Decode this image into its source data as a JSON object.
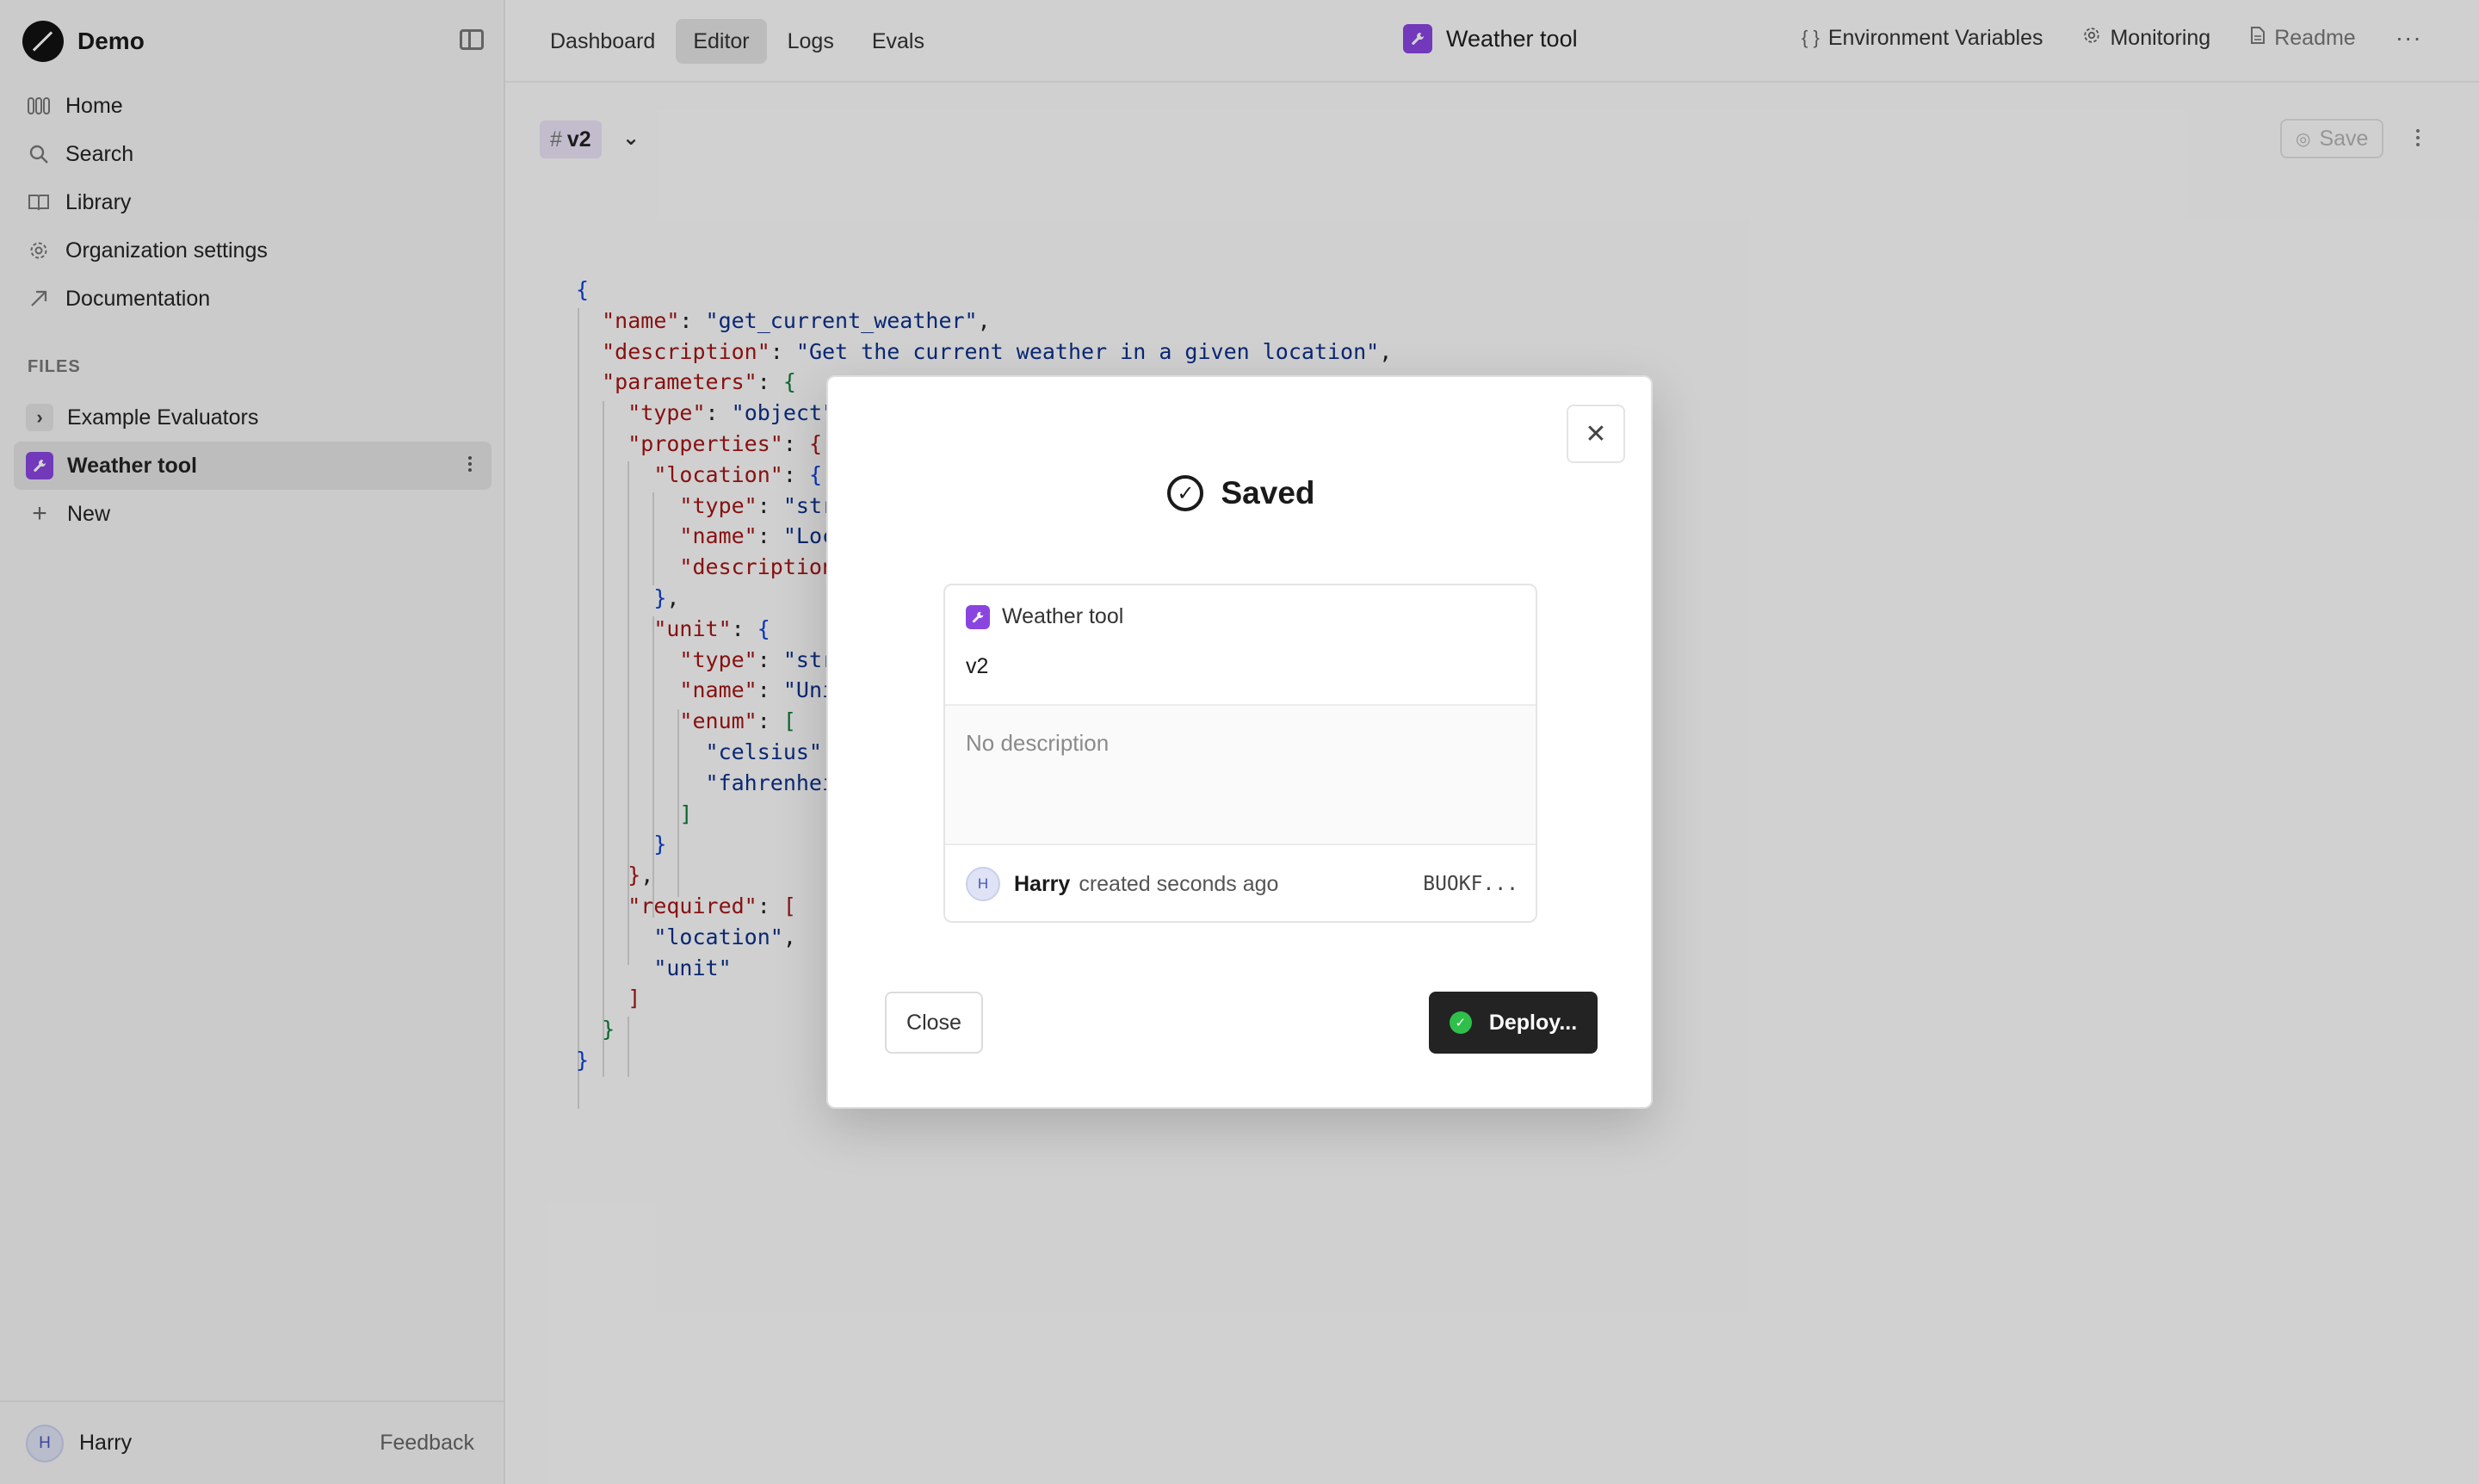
{
  "sidebar": {
    "org_name": "Demo",
    "nav": [
      {
        "label": "Home",
        "icon": "home-icon"
      },
      {
        "label": "Search",
        "icon": "search-icon"
      },
      {
        "label": "Library",
        "icon": "library-icon"
      },
      {
        "label": "Organization settings",
        "icon": "gear-icon"
      },
      {
        "label": "Documentation",
        "icon": "external-link-icon"
      }
    ],
    "files_label": "FILES",
    "files": [
      {
        "label": "Example Evaluators"
      },
      {
        "label": "Weather tool"
      },
      {
        "label": "New"
      }
    ],
    "footer": {
      "avatar_initial": "H",
      "user_name": "Harry",
      "feedback_label": "Feedback"
    }
  },
  "topbar": {
    "tabs": [
      {
        "label": "Dashboard"
      },
      {
        "label": "Editor"
      },
      {
        "label": "Logs"
      },
      {
        "label": "Evals"
      }
    ],
    "active_tab": "Editor",
    "tool_title": "Weather tool",
    "actions": {
      "env_vars": "Environment Variables",
      "monitoring": "Monitoring",
      "readme": "Readme"
    }
  },
  "editor": {
    "version_hash": "#",
    "version_label": "v2",
    "save_label": "Save"
  },
  "code": {
    "name_key": "\"name\"",
    "name_val": "\"get_current_weather\"",
    "desc_key": "\"description\"",
    "desc_val": "\"Get the current weather in a given location\"",
    "params_key": "\"parameters\"",
    "type_key": "\"type\"",
    "type_val": "\"object\"",
    "props_key": "\"properties\"",
    "location_key": "\"location\"",
    "loc_type_key": "\"type\"",
    "loc_type_val": "\"str",
    "loc_name_key": "\"name\"",
    "loc_name_val": "\"Loc",
    "loc_desc_key": "\"description",
    "unit_key": "\"unit\"",
    "unit_type_key": "\"type\"",
    "unit_type_val": "\"str",
    "unit_name_key": "\"name\"",
    "unit_name_val": "\"Uni",
    "enum_key": "\"enum\"",
    "enum_v1": "\"celsius\"",
    "enum_v2": "\"fahrenhei",
    "required_key": "\"required\"",
    "req_v1": "\"location\"",
    "req_v2": "\"unit\""
  },
  "modal": {
    "title": "Saved",
    "card": {
      "tool_name": "Weather tool",
      "version": "v2",
      "description": "No description",
      "author_initial": "H",
      "author": "Harry",
      "created": "created seconds ago",
      "id": "BUOKF..."
    },
    "close_label": "Close",
    "deploy_label": "Deploy..."
  },
  "colors": {
    "accent_purple": "#8a45e0",
    "deploy_bg": "#232323",
    "success_green": "#2fbf4b",
    "json_key": "#a31515",
    "json_string": "#0b2f8a"
  }
}
